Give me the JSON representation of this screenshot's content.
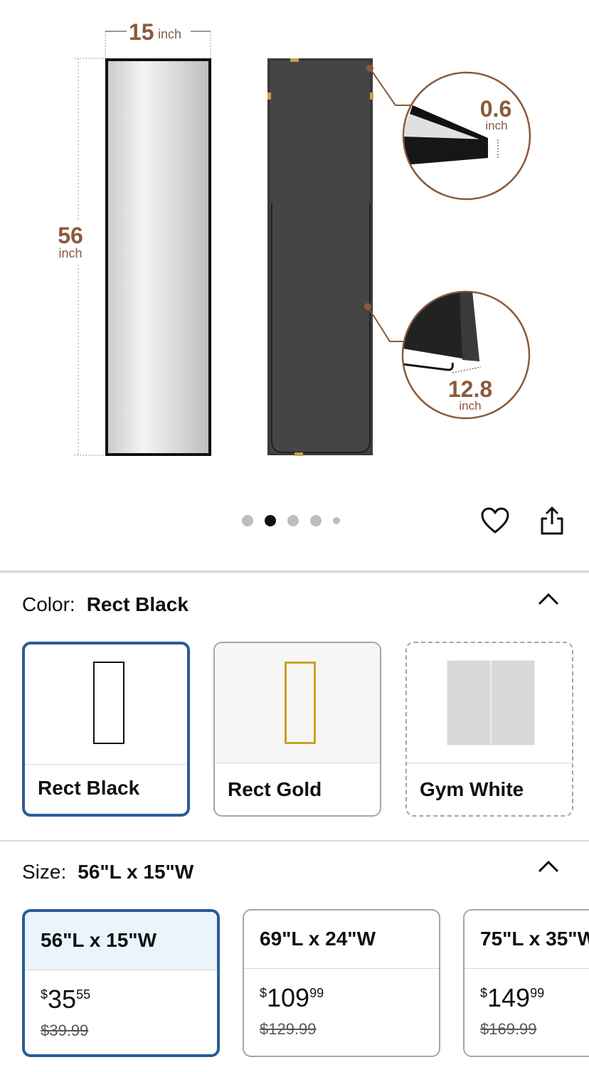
{
  "hero": {
    "width_value": "15",
    "width_unit": "inch",
    "height_value": "56",
    "height_unit": "inch",
    "thickness_value": "0.6",
    "thickness_unit": "inch",
    "stand_value": "12.8",
    "stand_unit": "inch"
  },
  "carousel": {
    "count": 5,
    "active_index": 1
  },
  "actions": {
    "wishlist_icon": "heart-icon",
    "share_icon": "share-icon"
  },
  "color": {
    "label": "Color:",
    "selected": "Rect Black",
    "options": [
      {
        "name": "Rect Black",
        "state": "selected"
      },
      {
        "name": "Rect Gold",
        "state": "available"
      },
      {
        "name": "Gym White",
        "state": "unavailable"
      }
    ]
  },
  "size": {
    "label": "Size:",
    "selected": "56\"L x 15\"W",
    "options": [
      {
        "name": "56\"L x 15\"W",
        "currency": "$",
        "whole": "35",
        "fraction": "55",
        "was": "$39.99"
      },
      {
        "name": "69\"L x 24\"W",
        "currency": "$",
        "whole": "109",
        "fraction": "99",
        "was": "$129.99"
      },
      {
        "name": "75\"L x 35\"W",
        "currency": "$",
        "whole": "149",
        "fraction": "99",
        "was": "$169.99"
      }
    ]
  },
  "colors": {
    "accent": "#2b5c96",
    "dimension": "#8a5a3b",
    "selected_bg": "#eaf4fd"
  }
}
